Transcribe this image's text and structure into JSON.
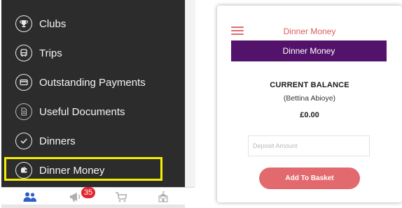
{
  "left_menu": {
    "items": [
      {
        "label": "Clubs",
        "icon": "trophy-icon"
      },
      {
        "label": "Trips",
        "icon": "bus-icon"
      },
      {
        "label": "Outstanding Payments",
        "icon": "card-icon"
      },
      {
        "label": "Useful Documents",
        "icon": "document-icon"
      },
      {
        "label": "Dinners",
        "icon": "check-icon"
      },
      {
        "label": "Dinner Money",
        "icon": "wallet-icon"
      }
    ],
    "highlighted_item": "Dinner Money",
    "highlight_color": "#f2ef00",
    "background_color": "#2c2c2c"
  },
  "tabbar": {
    "tabs": [
      {
        "icon": "users-icon"
      },
      {
        "icon": "megaphone-icon",
        "badge": "35"
      },
      {
        "icon": "cart-icon"
      },
      {
        "icon": "school-icon"
      }
    ],
    "active_color": "#2c5ec8",
    "badge_color": "#e3262f"
  },
  "right_panel": {
    "header_title": "Dinner Money",
    "banner_title": "Dinner Money",
    "balance_label": "CURRENT BALANCE",
    "account_name": "(Bettina Abioye)",
    "balance_amount": "£0.00",
    "deposit_placeholder": "Deposit Amount",
    "deposit_value": "",
    "add_button_label": "Add To Basket",
    "accent_color": "#de5b5b",
    "banner_color": "#54136b",
    "button_color": "#e26a6f"
  }
}
